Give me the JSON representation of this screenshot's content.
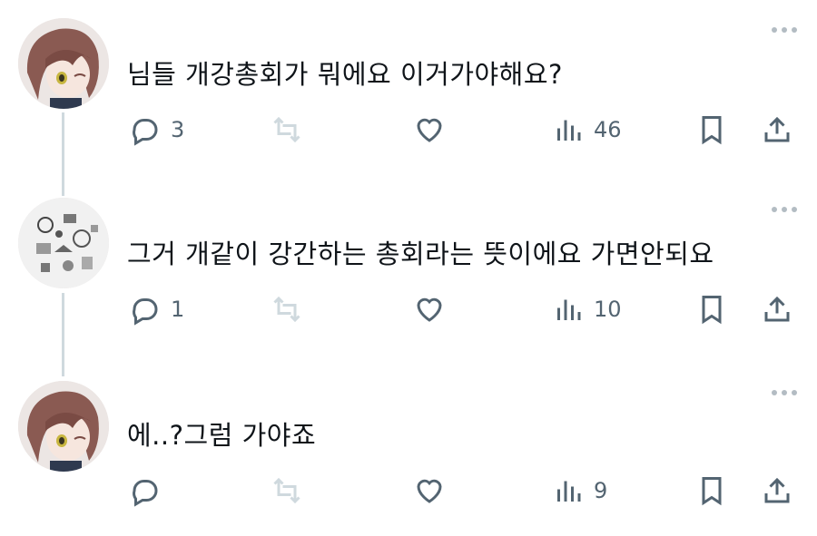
{
  "posts": [
    {
      "avatar": "anime-character-avatar",
      "text": "님들 개강총회가 뭐에요 이거가야해요?",
      "replies": "3",
      "views": "46"
    },
    {
      "avatar": "collage-doodle-avatar",
      "text": "그거 개같이 강간하는 총회라는 뜻이에요 가면안되요",
      "replies": "1",
      "views": "10"
    },
    {
      "avatar": "anime-character-avatar",
      "text": "에..?그럼 가야죠",
      "replies": "",
      "views": "9"
    }
  ],
  "icons": {
    "reply": "reply-icon",
    "retweet": "retweet-icon",
    "like": "heart-icon",
    "views": "views-icon",
    "bookmark": "bookmark-icon",
    "share": "share-icon",
    "more": "more-icon"
  },
  "colors": {
    "text": "#0f1419",
    "icon": "#536471",
    "disabled": "#cfd9de",
    "thread_line": "#cfd9de"
  }
}
